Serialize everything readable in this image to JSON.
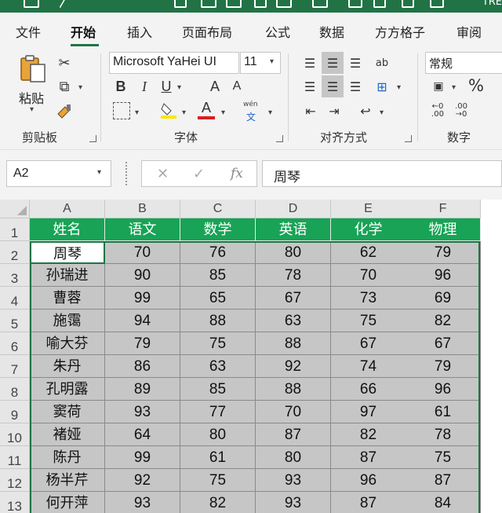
{
  "titlebar": {
    "right_text": "TRE"
  },
  "tabs": [
    "文件",
    "开始",
    "插入",
    "页面布局",
    "公式",
    "数据",
    "方方格子",
    "审阅"
  ],
  "active_tab": "开始",
  "ribbon": {
    "clipboard": {
      "paste_label": "粘贴",
      "group_label": "剪贴板"
    },
    "font": {
      "font_name": "Microsoft YaHei UI",
      "font_size": "11",
      "bold": "B",
      "italic": "I",
      "underline": "U",
      "grow": "A",
      "shrink": "A",
      "font_color_letter": "A",
      "phonetic": "wén",
      "phonetic_glyph": "文",
      "group_label": "字体"
    },
    "alignment": {
      "group_label": "对齐方式"
    },
    "number": {
      "format": "常规",
      "percent": "%",
      "group_label": "数字"
    }
  },
  "formula_bar": {
    "name_box": "A2",
    "fx": "fx",
    "content": "周琴"
  },
  "columns": [
    "A",
    "B",
    "C",
    "D",
    "E",
    "F"
  ],
  "row_numbers": [
    "1",
    "2",
    "3",
    "4",
    "5",
    "6",
    "7",
    "8",
    "9",
    "10",
    "11",
    "12",
    "13"
  ],
  "headers": [
    "姓名",
    "语文",
    "数学",
    "英语",
    "化学",
    "物理"
  ],
  "rows": [
    [
      "周琴",
      "70",
      "76",
      "80",
      "62",
      "79"
    ],
    [
      "孙瑞进",
      "90",
      "85",
      "78",
      "70",
      "96"
    ],
    [
      "曹蓉",
      "99",
      "65",
      "67",
      "73",
      "69"
    ],
    [
      "施霭",
      "94",
      "88",
      "63",
      "75",
      "82"
    ],
    [
      "喻大芬",
      "79",
      "75",
      "88",
      "67",
      "67"
    ],
    [
      "朱丹",
      "86",
      "63",
      "92",
      "74",
      "79"
    ],
    [
      "孔明露",
      "89",
      "85",
      "88",
      "66",
      "96"
    ],
    [
      "窦荷",
      "93",
      "77",
      "70",
      "97",
      "61"
    ],
    [
      "褚娅",
      "64",
      "80",
      "87",
      "82",
      "78"
    ],
    [
      "陈丹",
      "99",
      "61",
      "80",
      "87",
      "75"
    ],
    [
      "杨半芹",
      "92",
      "75",
      "93",
      "96",
      "87"
    ],
    [
      "何开萍",
      "93",
      "82",
      "93",
      "87",
      "84"
    ]
  ],
  "colors": {
    "excel_green": "#217346",
    "header_fill": "#18a356",
    "selection_fill": "#c6c6c6"
  }
}
